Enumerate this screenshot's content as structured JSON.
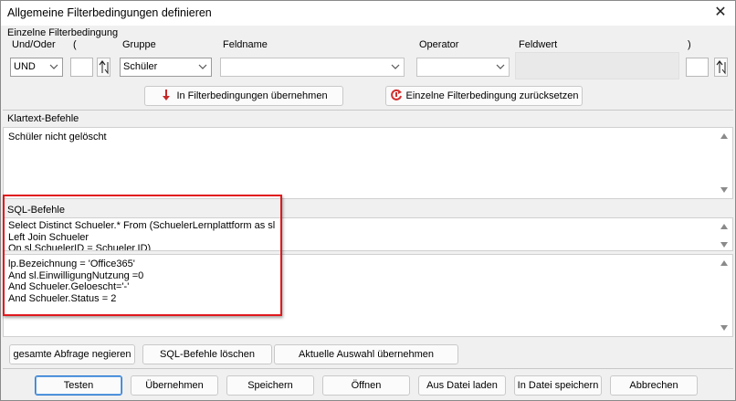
{
  "window": {
    "title": "Allgemeine Filterbedingungen definieren",
    "close_glyph": "✕"
  },
  "filter": {
    "group_label": "Einzelne Filterbedingung",
    "columns": {
      "und_oder": "Und/Oder",
      "open_paren": "(",
      "gruppe": "Gruppe",
      "feldname": "Feldname",
      "operator": "Operator",
      "feldwert": "Feldwert",
      "close_paren": ")"
    },
    "und_oder_value": "UND",
    "open_paren_value": "",
    "gruppe_value": "Schüler",
    "feldname_value": "",
    "operator_value": "",
    "close_paren_value": "",
    "apply_button": "In Filterbedingungen übernehmen",
    "reset_button": "Einzelne Filterbedingung zurücksetzen"
  },
  "klartext": {
    "label": "Klartext-Befehle",
    "text": "Schüler nicht gelöscht"
  },
  "sql": {
    "label": "SQL-Befehle",
    "text_upper": "Select Distinct Schueler.* From (SchuelerLernplattform as sl\nLeft Join Schueler\nOn sl.SchuelerID = Schueler.ID)",
    "text_lower": "lp.Bezeichnung = 'Office365'\nAnd sl.EinwilligungNutzung =0\nAnd Schueler.Geloescht='-'\nAnd Schueler.Status = 2"
  },
  "sql_actions": {
    "negate": "gesamte Abfrage negieren",
    "clear": "SQL-Befehle löschen",
    "apply_current": "Aktuelle Auswahl übernehmen"
  },
  "footer": {
    "test": "Testen",
    "accept": "Übernehmen",
    "save": "Speichern",
    "open": "Öffnen",
    "load_file": "Aus Datei laden",
    "save_file": "In Datei speichern",
    "cancel": "Abbrechen"
  },
  "colors": {
    "highlight": "#e0191d",
    "apply_arrow": "#c62828",
    "reset_icon": "#d32f2f",
    "primary_border": "#2f7bd2"
  }
}
